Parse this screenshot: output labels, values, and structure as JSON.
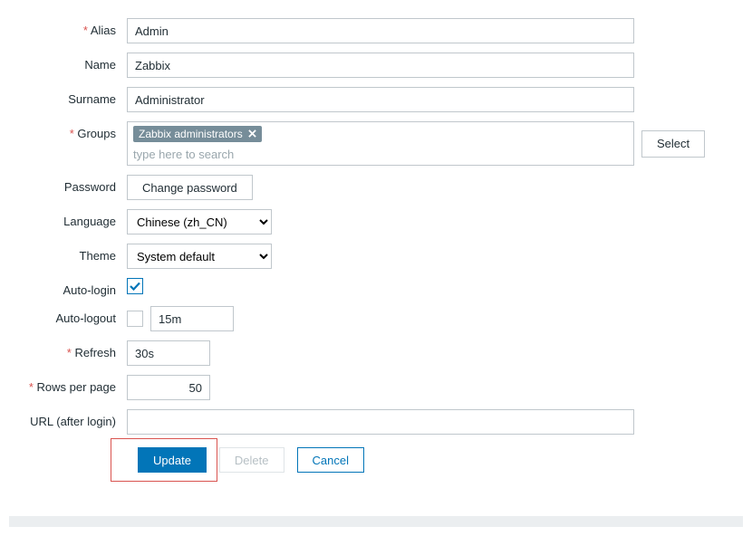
{
  "labels": {
    "alias": "Alias",
    "name": "Name",
    "surname": "Surname",
    "groups": "Groups",
    "password": "Password",
    "language": "Language",
    "theme": "Theme",
    "auto_login": "Auto-login",
    "auto_logout": "Auto-logout",
    "refresh": "Refresh",
    "rows_per_page": "Rows per page",
    "url_after_login": "URL (after login)"
  },
  "values": {
    "alias": "Admin",
    "name": "Zabbix",
    "surname": "Administrator",
    "groups_tag": "Zabbix administrators",
    "groups_placeholder": "type here to search",
    "select_btn": "Select",
    "change_password": "Change password",
    "language": "Chinese (zh_CN)",
    "theme": "System default",
    "auto_login_checked": true,
    "auto_logout_checked": false,
    "auto_logout_value": "15m",
    "refresh": "30s",
    "rows_per_page": "50",
    "url_after_login": ""
  },
  "buttons": {
    "update": "Update",
    "delete": "Delete",
    "cancel": "Cancel"
  }
}
